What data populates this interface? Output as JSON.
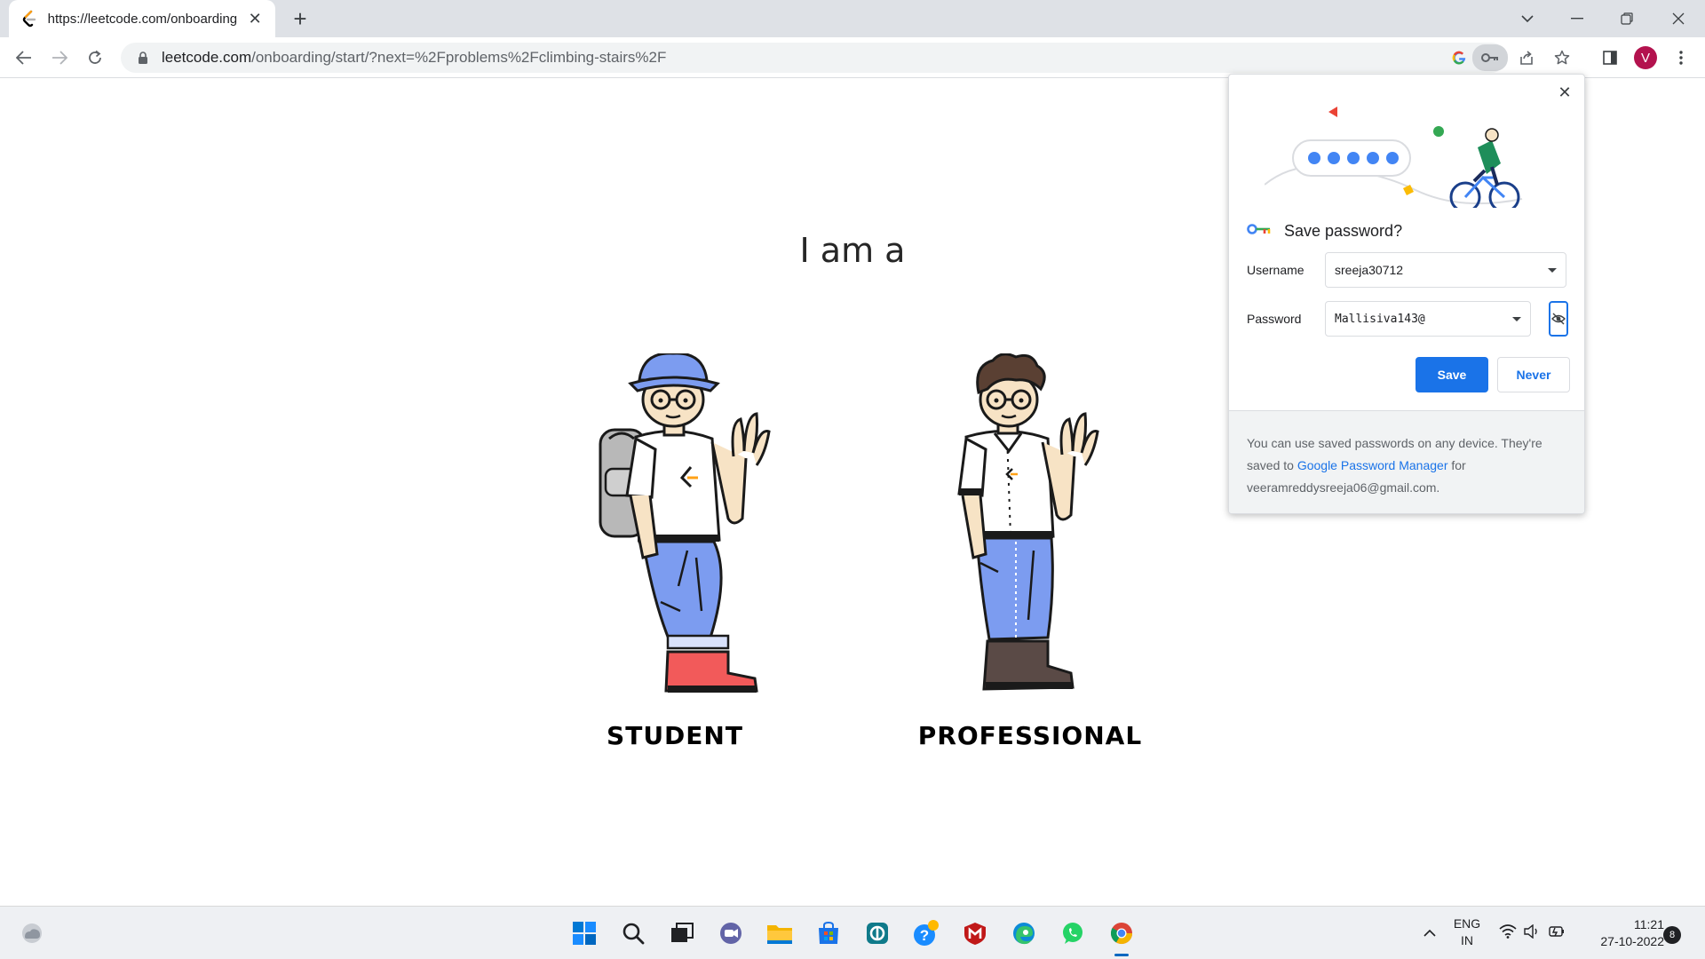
{
  "browser": {
    "tab_title": "https://leetcode.com/onboarding",
    "new_tab_symbol": "+",
    "url_host": "leetcode.com",
    "url_path": "/onboarding/start/?next=%2Fproblems%2Fclimbing-stairs%2F",
    "profile_initial": "V"
  },
  "page": {
    "heading": "I am a",
    "options": [
      {
        "label": "STUDENT"
      },
      {
        "label": "PROFESSIONAL"
      }
    ]
  },
  "password_popup": {
    "title": "Save password?",
    "username_label": "Username",
    "username_value": "sreeja30712",
    "password_label": "Password",
    "password_value": "Mallisiva143@",
    "save_label": "Save",
    "never_label": "Never",
    "footer_text_1": "You can use saved passwords on any device. They're saved to ",
    "footer_link": "Google Password Manager",
    "footer_text_2": " for",
    "footer_email": "veeramreddysreeja06@gmail.com."
  },
  "taskbar": {
    "lang_1": "ENG",
    "lang_2": "IN",
    "time": "11:21",
    "date": "27-10-2022",
    "notification_count": "8"
  },
  "colors": {
    "accent": "#1a73e8",
    "tab_strip": "#dee1e6",
    "taskbar": "#eef0f3"
  }
}
